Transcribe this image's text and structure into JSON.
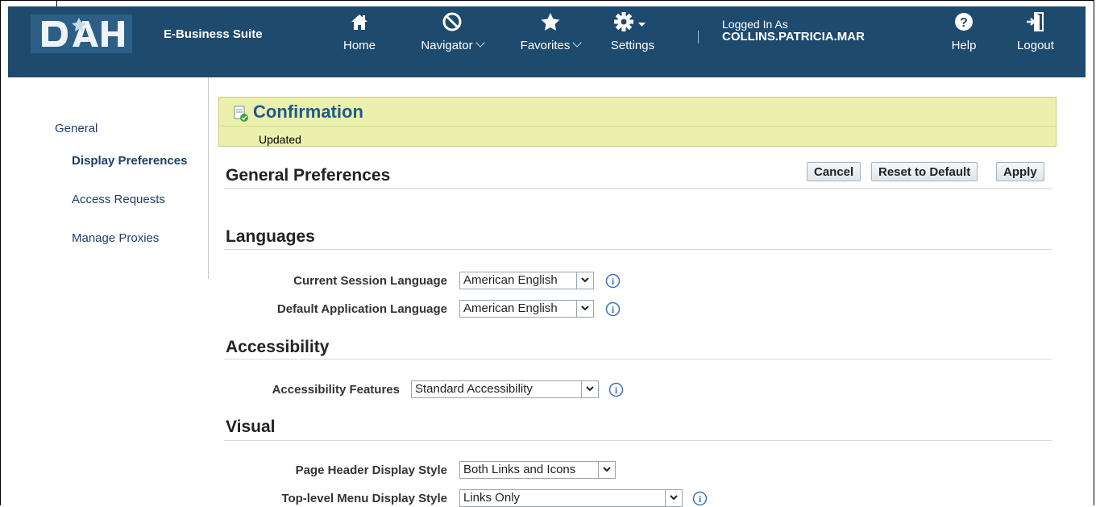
{
  "app": {
    "suite_title": "E-Business Suite",
    "logged_in_label": "Logged In As",
    "user": "COLLINS.PATRICIA.MAR"
  },
  "nav": {
    "home": "Home",
    "navigator": "Navigator",
    "favorites": "Favorites",
    "settings": "Settings",
    "help": "Help",
    "logout": "Logout"
  },
  "sidebar": {
    "items": [
      {
        "label": "General"
      },
      {
        "label": "Display Preferences"
      },
      {
        "label": "Access Requests"
      },
      {
        "label": "Manage Proxies"
      }
    ]
  },
  "confirmation": {
    "title": "Confirmation",
    "message": "Updated"
  },
  "page": {
    "title": "General Preferences",
    "buttons": {
      "cancel": "Cancel",
      "reset": "Reset to Default",
      "apply": "Apply"
    }
  },
  "languages": {
    "title": "Languages",
    "current_label": "Current Session Language",
    "current_value": "American English",
    "default_label": "Default Application Language",
    "default_value": "American English"
  },
  "accessibility": {
    "title": "Accessibility",
    "features_label": "Accessibility Features",
    "features_value": "Standard Accessibility"
  },
  "visual": {
    "title": "Visual",
    "header_style_label": "Page Header Display Style",
    "header_style_value": "Both Links and Icons",
    "menu_style_label": "Top-level Menu Display Style",
    "menu_style_value": "Links Only"
  },
  "colors": {
    "header_bg": "#1e4a6e",
    "confirmation_bg": "#ebf0ad",
    "link": "#1f3f66",
    "confirmation_title": "#1e5a8a"
  }
}
